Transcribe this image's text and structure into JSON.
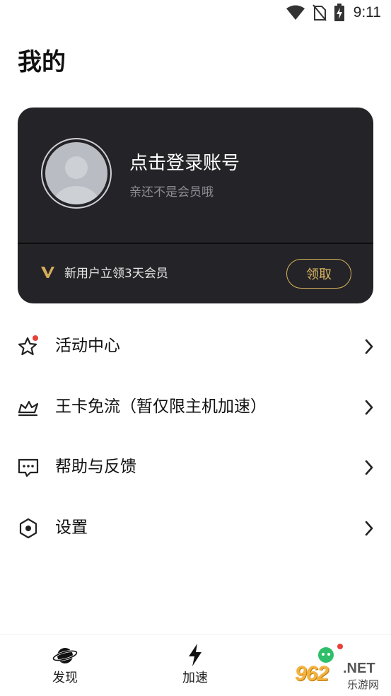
{
  "status_bar": {
    "time": "9:11",
    "icons": [
      "wifi-icon",
      "no-sim-icon",
      "battery-charging-icon"
    ]
  },
  "page": {
    "title": "我的"
  },
  "profile_card": {
    "login_title": "点击登录账号",
    "login_subtitle": "亲还不是会员哦",
    "promo_text": "新用户立领3天会员",
    "claim_button_label": "领取",
    "accent_color": "#dcb763",
    "card_color": "#242428"
  },
  "menu": [
    {
      "label": "活动中心",
      "icon": "star-icon",
      "has_badge": true
    },
    {
      "label": "王卡免流（暂仅限主机加速）",
      "icon": "crown-icon",
      "has_badge": false
    },
    {
      "label": "帮助与反馈",
      "icon": "feedback-icon",
      "has_badge": false
    },
    {
      "label": "设置",
      "icon": "settings-icon",
      "has_badge": false
    }
  ],
  "bottom_nav": [
    {
      "label": "发现",
      "icon": "planet-icon"
    },
    {
      "label": "加速",
      "icon": "lightning-icon"
    }
  ],
  "watermark": {
    "number": "962",
    "domain": ".NET",
    "text": "乐游网"
  }
}
